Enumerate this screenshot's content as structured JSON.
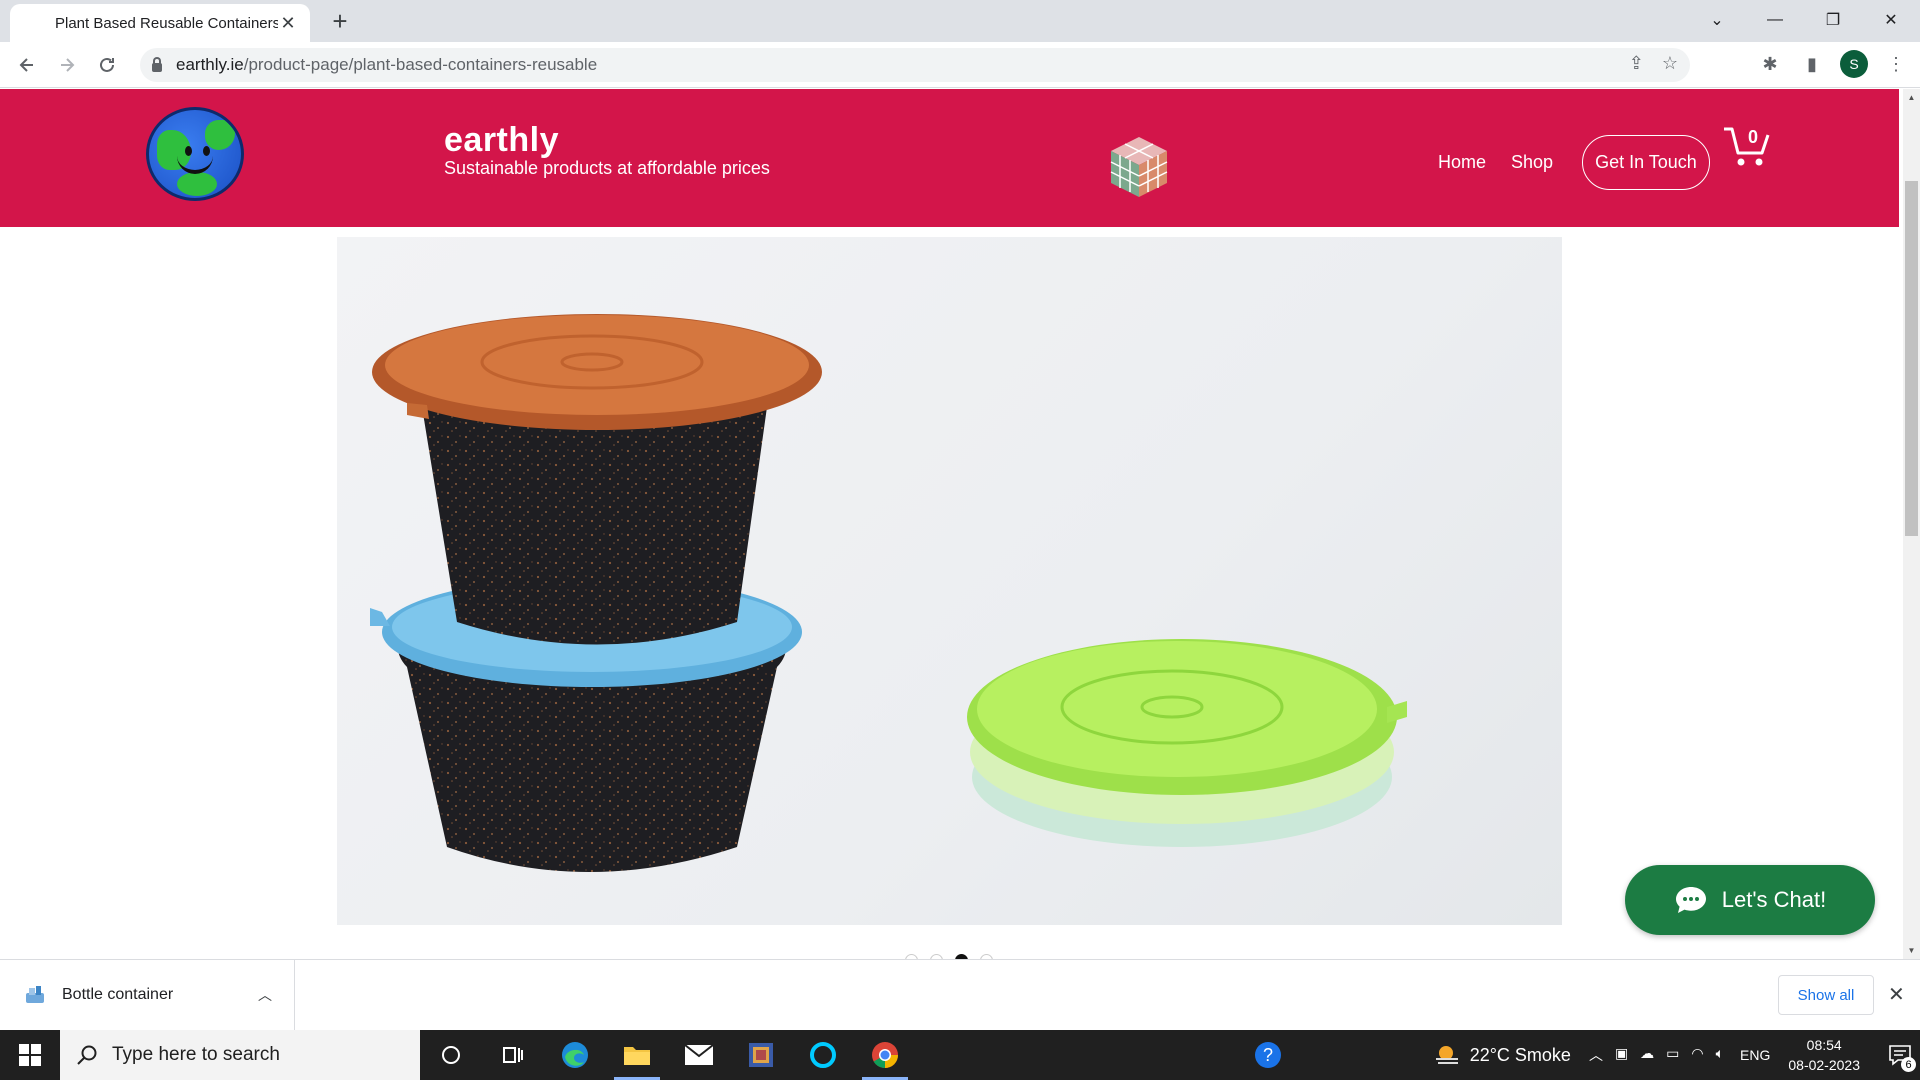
{
  "browser": {
    "tab_title": "Plant Based Reusable Containers",
    "tab_close": "✕",
    "new_tab": "+",
    "url_domain": "earthly.ie",
    "url_path": "/product-page/plant-based-containers-reusable",
    "profile_initial": "S"
  },
  "site": {
    "brand_name": "earthly",
    "tagline": "Sustainable products at affordable prices",
    "nav": {
      "home": "Home",
      "shop": "Shop",
      "contact": "Get In Touch"
    },
    "cart_count": "0",
    "accent_color": "#d3154a",
    "gallery_dots": {
      "total": 4,
      "active_index": 2
    },
    "chat_label": "Let's Chat!",
    "chat_color": "#1c7c43"
  },
  "downloads": {
    "file_name": "Bottle container",
    "show_all": "Show all",
    "close": "✕"
  },
  "taskbar": {
    "search_placeholder": "Type here to search",
    "weather": "22°C  Smoke",
    "language": "ENG",
    "time": "08:54",
    "date": "08-02-2023",
    "notification_count": "6"
  }
}
